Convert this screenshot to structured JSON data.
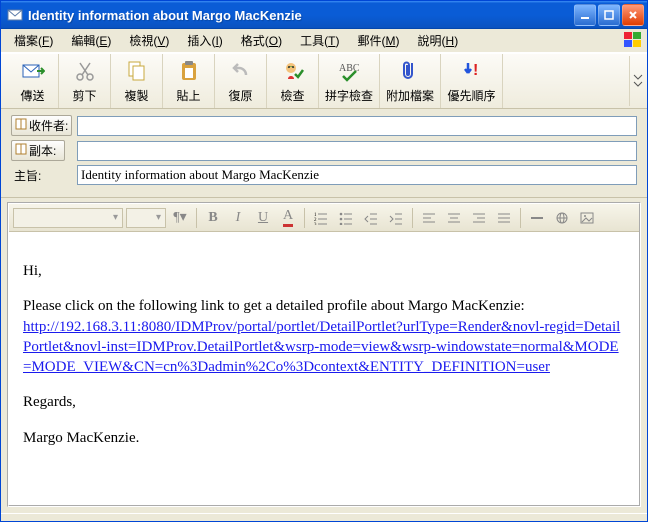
{
  "window": {
    "title": "Identity information about Margo MacKenzie"
  },
  "menu": {
    "items": [
      {
        "label": "檔案",
        "accel": "F"
      },
      {
        "label": "編輯",
        "accel": "E"
      },
      {
        "label": "檢視",
        "accel": "V"
      },
      {
        "label": "插入",
        "accel": "I"
      },
      {
        "label": "格式",
        "accel": "O"
      },
      {
        "label": "工具",
        "accel": "T"
      },
      {
        "label": "郵件",
        "accel": "M"
      },
      {
        "label": "說明",
        "accel": "H"
      }
    ]
  },
  "toolbar": {
    "send": "傳送",
    "cut": "剪下",
    "copy": "複製",
    "paste": "貼上",
    "undo": "復原",
    "check": "檢查",
    "spell": "拼字檢查",
    "attach": "附加檔案",
    "priority": "優先順序"
  },
  "fields": {
    "to_label": "收件者:",
    "cc_label": "副本:",
    "subject_label": "主旨:",
    "to_value": "",
    "cc_value": "",
    "subject_value": "Identity information about Margo MacKenzie"
  },
  "body": {
    "greeting": "Hi,",
    "intro": "Please click on the following link to get a detailed profile about Margo MacKenzie:",
    "link": "http://192.168.3.11:8080/IDMProv/portal/portlet/DetailPortlet?urlType=Render&novl-regid=DetailPortlet&novl-inst=IDMProv.DetailPortlet&wsrp-mode=view&wsrp-windowstate=normal&MODE=MODE_VIEW&CN=cn%3Dadmin%2Co%3Dcontext&ENTITY_DEFINITION=user",
    "regards": "Regards,",
    "signature": "Margo MacKenzie."
  }
}
